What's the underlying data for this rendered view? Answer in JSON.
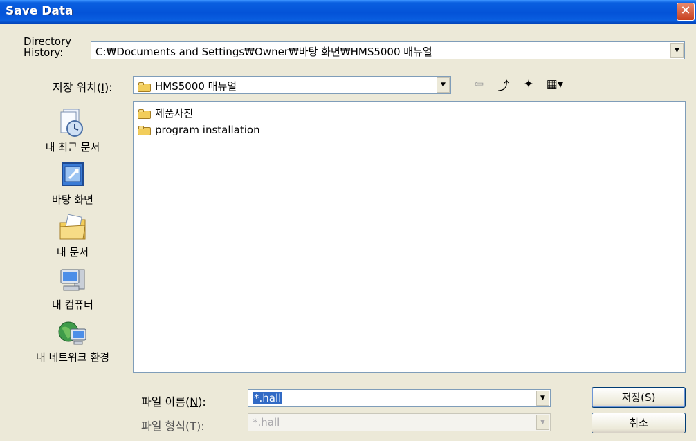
{
  "window": {
    "title": "Save Data",
    "close_glyph": "✕"
  },
  "directory_history": {
    "label_line1": "Directory",
    "label_line2_underlined": "H",
    "label_line2_rest": "istory:",
    "value": "C:₩Documents and Settings₩Owner₩바탕 화면₩HMS5000 매뉴얼"
  },
  "save_in": {
    "label_prefix": "저장 위치(",
    "label_key": "I",
    "label_suffix": "):",
    "value": "HMS5000 매뉴얼"
  },
  "toolbar": {
    "back_glyph": "⇦",
    "up_glyph": "⤴",
    "new_folder_glyph": "✦",
    "view_glyph": "▦▾"
  },
  "places": [
    {
      "label": "내 최근 문서",
      "icon": "recent-documents-icon"
    },
    {
      "label": "바탕 화면",
      "icon": "desktop-icon"
    },
    {
      "label": "내 문서",
      "icon": "my-documents-icon"
    },
    {
      "label": "내 컴퓨터",
      "icon": "my-computer-icon"
    },
    {
      "label": "내 네트워크 환경",
      "icon": "network-places-icon"
    }
  ],
  "files": [
    {
      "name": "제품사진",
      "icon": "folder-icon"
    },
    {
      "name": "program installation",
      "icon": "folder-icon"
    }
  ],
  "file_name": {
    "label_prefix": "파일 이름(",
    "label_key": "N",
    "label_suffix": "):",
    "value": "*.hall"
  },
  "file_type": {
    "label_prefix": "파일 형식(",
    "label_key": "T",
    "label_suffix": "):",
    "value": "*.hall"
  },
  "buttons": {
    "save_prefix": "저장(",
    "save_key": "S",
    "save_suffix": ")",
    "cancel": "취소"
  },
  "colors": {
    "titlebar": "#0453d8",
    "selection": "#316ac5",
    "dialog_bg": "#ece9d8"
  }
}
